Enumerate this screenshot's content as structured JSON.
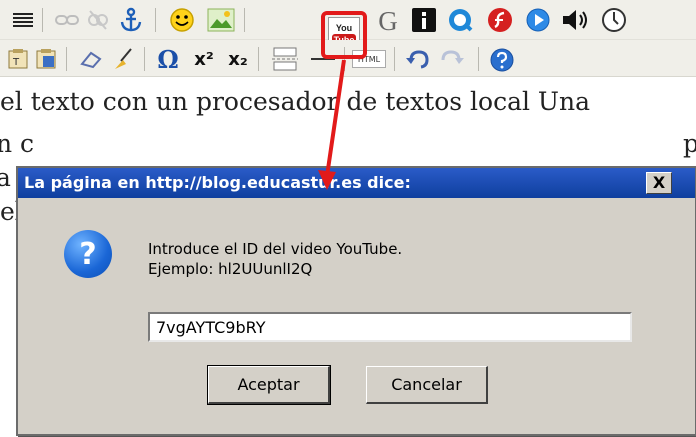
{
  "editor": {
    "lines": [
      "el texto con un procesador de textos local Una",
      "n c",
      "a p",
      "el"
    ],
    "right_fragment": "p"
  },
  "toolbar1": {
    "icons": [
      "justify-full-icon",
      "unlink-icon",
      "unlink-disabled-icon",
      "anchor-icon",
      "smiley-icon",
      "image-icon",
      "youtube-icon",
      "google-icon",
      "info-icon",
      "quicktime-icon",
      "flash-icon",
      "media-icon",
      "audio-icon",
      "clock-icon"
    ],
    "youtube_label_top": "You",
    "youtube_label_bottom": "Tube"
  },
  "toolbar2": {
    "html_label": "HTML",
    "superscript_label": "x²",
    "subscript_label": "x₂"
  },
  "dialog": {
    "title": "La página en http://blog.educastur.es dice:",
    "close_label": "X",
    "message_line1": "Introduce el ID del video YouTube.",
    "message_line2": "Ejemplo: hl2UUunlI2Q",
    "input_value": "7vgAYTC9bRY",
    "ok_label": "Aceptar",
    "cancel_label": "Cancelar",
    "question_glyph": "?"
  },
  "colors": {
    "title_bar": "#1e4fb8",
    "annotation": "#e21a1a",
    "dialog_bg": "#d4d0c8",
    "toolbar_bg": "#f0efe9"
  }
}
